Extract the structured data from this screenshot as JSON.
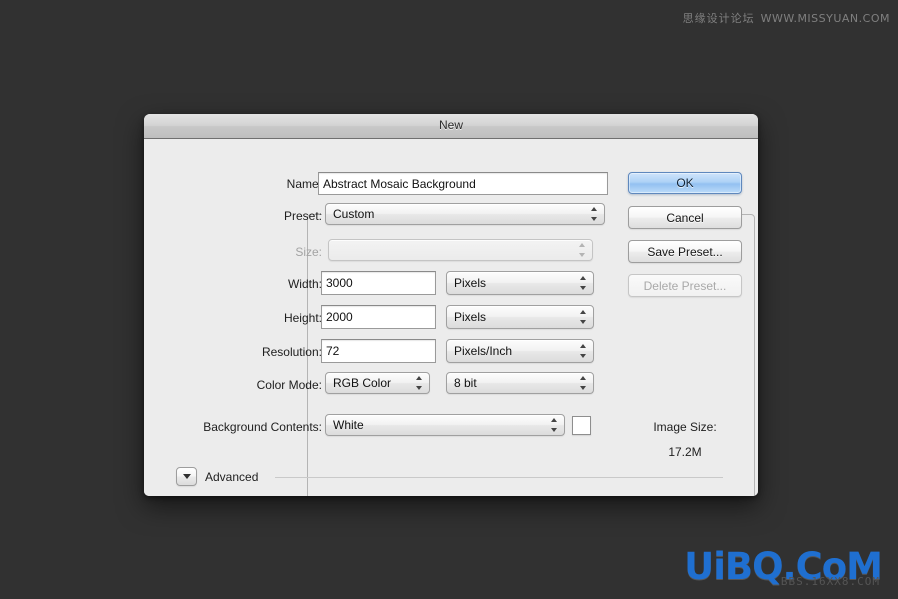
{
  "window": {
    "title": "New"
  },
  "form": {
    "name_label": "Name:",
    "name_value": "Abstract Mosaic Background",
    "preset_label": "Preset:",
    "preset_value": "Custom",
    "size_label": "Size:",
    "size_value": "",
    "width_label": "Width:",
    "width_value": "3000",
    "width_unit": "Pixels",
    "height_label": "Height:",
    "height_value": "2000",
    "height_unit": "Pixels",
    "resolution_label": "Resolution:",
    "resolution_value": "72",
    "resolution_unit": "Pixels/Inch",
    "color_mode_label": "Color Mode:",
    "color_mode_value": "RGB Color",
    "color_depth_value": "8 bit",
    "background_contents_label": "Background Contents:",
    "background_contents_value": "White",
    "background_swatch_color": "#ffffff",
    "advanced_label": "Advanced"
  },
  "buttons": {
    "ok": "OK",
    "cancel": "Cancel",
    "save_preset": "Save Preset...",
    "delete_preset": "Delete Preset..."
  },
  "info": {
    "image_size_label": "Image Size:",
    "image_size_value": "17.2M"
  },
  "watermarks": {
    "top_cn": "思缘设计论坛",
    "top_url": "WWW.MISSYUAN.COM",
    "bottom_logo": "UiBQ.CoM",
    "bottom_sub": "BBS.16XX8.COM"
  },
  "colors": {
    "desktop": "#313131",
    "dialog_body": "#ececec",
    "default_button_blue": "#aed2f6",
    "logo_blue": "#1f6fd0"
  }
}
